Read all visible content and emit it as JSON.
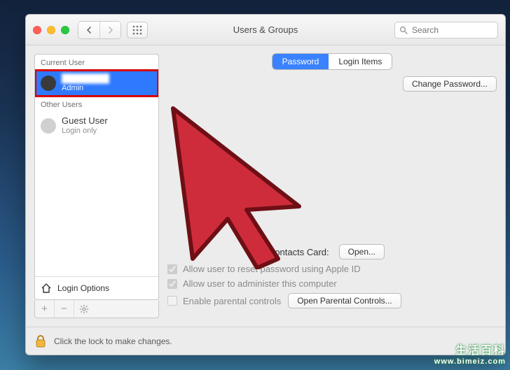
{
  "window": {
    "title": "Users & Groups",
    "search_placeholder": "Search"
  },
  "sidebar": {
    "current_header": "Current User",
    "other_header": "Other Users",
    "current": {
      "name": "████████",
      "role": "Admin"
    },
    "guest": {
      "name": "Guest User",
      "role": "Login only"
    },
    "login_options_label": "Login Options",
    "footer_add": "+",
    "footer_remove": "−",
    "footer_gear": "⚙"
  },
  "tabs": {
    "password": "Password",
    "login_items": "Login Items"
  },
  "buttons": {
    "change_password": "Change Password...",
    "open_card": "Open...",
    "open_parental": "Open Parental Controls..."
  },
  "main": {
    "contacts_label": "Contacts Card:",
    "chk_apple_id": "Allow user to reset password using Apple ID",
    "chk_admin": "Allow user to administer this computer",
    "chk_parental": "Enable parental controls"
  },
  "lockbar": {
    "text": "Click the lock to make changes."
  },
  "watermark": {
    "line1": "生活百科",
    "line2": "www.bimeiz.com"
  }
}
